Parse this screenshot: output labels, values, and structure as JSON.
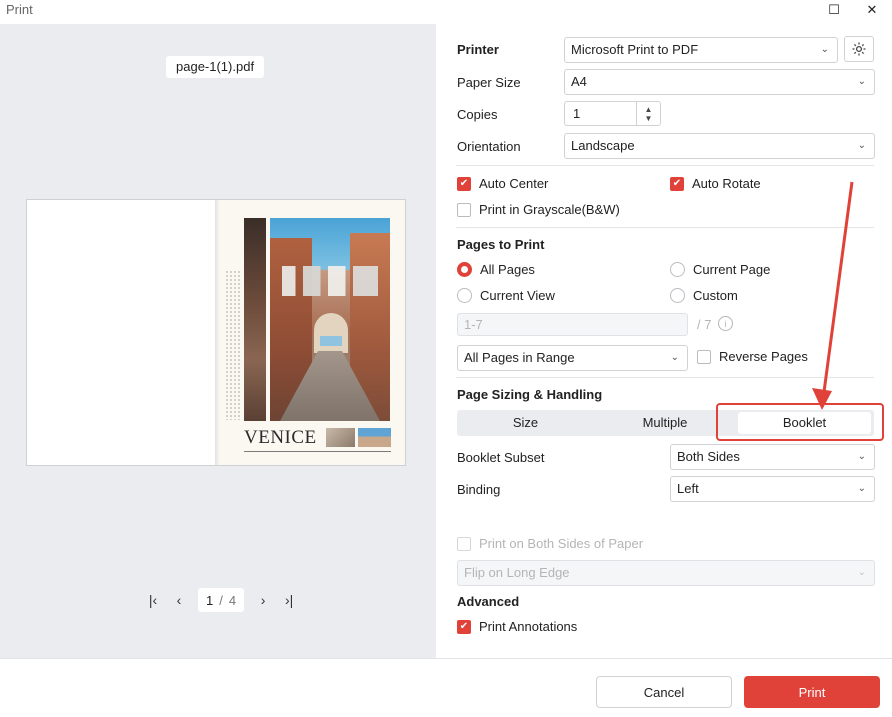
{
  "window": {
    "title": "Print"
  },
  "preview": {
    "filename": "page-1(1).pdf",
    "page_title_text": "VENICE",
    "current_page": "1",
    "page_separator": "/",
    "total_pages": "4"
  },
  "printer": {
    "label": "Printer",
    "value": "Microsoft Print to PDF"
  },
  "paper_size": {
    "label": "Paper Size",
    "value": "A4"
  },
  "copies": {
    "label": "Copies",
    "value": "1"
  },
  "orientation": {
    "label": "Orientation",
    "value": "Landscape"
  },
  "options": {
    "auto_center": {
      "label": "Auto Center",
      "checked": true
    },
    "auto_rotate": {
      "label": "Auto Rotate",
      "checked": true
    },
    "grayscale": {
      "label": "Print in Grayscale(B&W)",
      "checked": false
    }
  },
  "pages_to_print": {
    "heading": "Pages to Print",
    "all_pages": "All Pages",
    "current_page": "Current Page",
    "current_view": "Current View",
    "custom": "Custom",
    "selected": "All Pages",
    "range_placeholder": "1-7",
    "range_total": "/ 7",
    "subset_value": "All Pages in Range",
    "reverse_pages": "Reverse Pages"
  },
  "sizing": {
    "heading": "Page Sizing & Handling",
    "tabs": [
      "Size",
      "Multiple",
      "Booklet"
    ],
    "active_tab": "Booklet",
    "booklet_subset_label": "Booklet Subset",
    "booklet_subset_value": "Both Sides",
    "binding_label": "Binding",
    "binding_value": "Left"
  },
  "duplex": {
    "label": "Print on Both Sides of Paper",
    "flip_value": "Flip on Long Edge"
  },
  "advanced": {
    "heading": "Advanced",
    "print_annotations": "Print Annotations"
  },
  "buttons": {
    "cancel": "Cancel",
    "print": "Print"
  },
  "icons": {
    "settings": "gear-icon",
    "first": "first-page-icon",
    "prev": "prev-page-icon",
    "next": "next-page-icon",
    "last": "last-page-icon",
    "annotation": "red-arrow-annotation",
    "info": "info-icon"
  },
  "colors": {
    "accent": "#e0423a",
    "panel_bg": "#ebecef"
  }
}
